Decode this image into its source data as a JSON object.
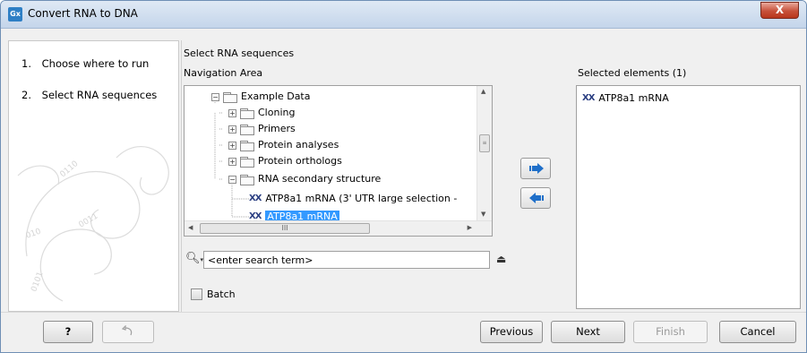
{
  "window": {
    "title": "Convert RNA to DNA",
    "app_icon": "Gx",
    "close_label": "X"
  },
  "steps": [
    {
      "num": "1.",
      "label": "Choose where to run"
    },
    {
      "num": "2.",
      "label": "Select RNA sequences"
    }
  ],
  "section_title": "Select RNA sequences",
  "nav_label": "Navigation Area",
  "selected_label": "Selected elements (1)",
  "tree": [
    {
      "label": "Example Data",
      "type": "folder",
      "expander": "−"
    },
    {
      "label": "Cloning",
      "type": "folder",
      "expander": "+"
    },
    {
      "label": "Primers",
      "type": "folder",
      "expander": "+"
    },
    {
      "label": "Protein analyses",
      "type": "folder",
      "expander": "+"
    },
    {
      "label": "Protein orthologs",
      "type": "folder",
      "expander": "+"
    },
    {
      "label": "RNA secondary structure",
      "type": "folder",
      "expander": "−"
    },
    {
      "label": "ATP8a1 mRNA (3' UTR large selection -",
      "type": "sequence"
    },
    {
      "label": "ATP8a1 mRNA",
      "type": "sequence",
      "selected": true
    }
  ],
  "sequence_icon_glyph": "ⅩⅩ",
  "hscroll_grip": "III",
  "search": {
    "placeholder": "<enter search term>",
    "value": "<enter search term>"
  },
  "batch_label": "Batch",
  "selected_elements": [
    {
      "label": "ATP8a1 mRNA"
    }
  ],
  "buttons": {
    "help": "?",
    "previous": "Previous",
    "next": "Next",
    "finish": "Finish",
    "cancel": "Cancel"
  },
  "colors": {
    "selection": "#3399ff",
    "arrow_blue": "#1f6fc9",
    "seq_icon": "#2b3f82"
  }
}
